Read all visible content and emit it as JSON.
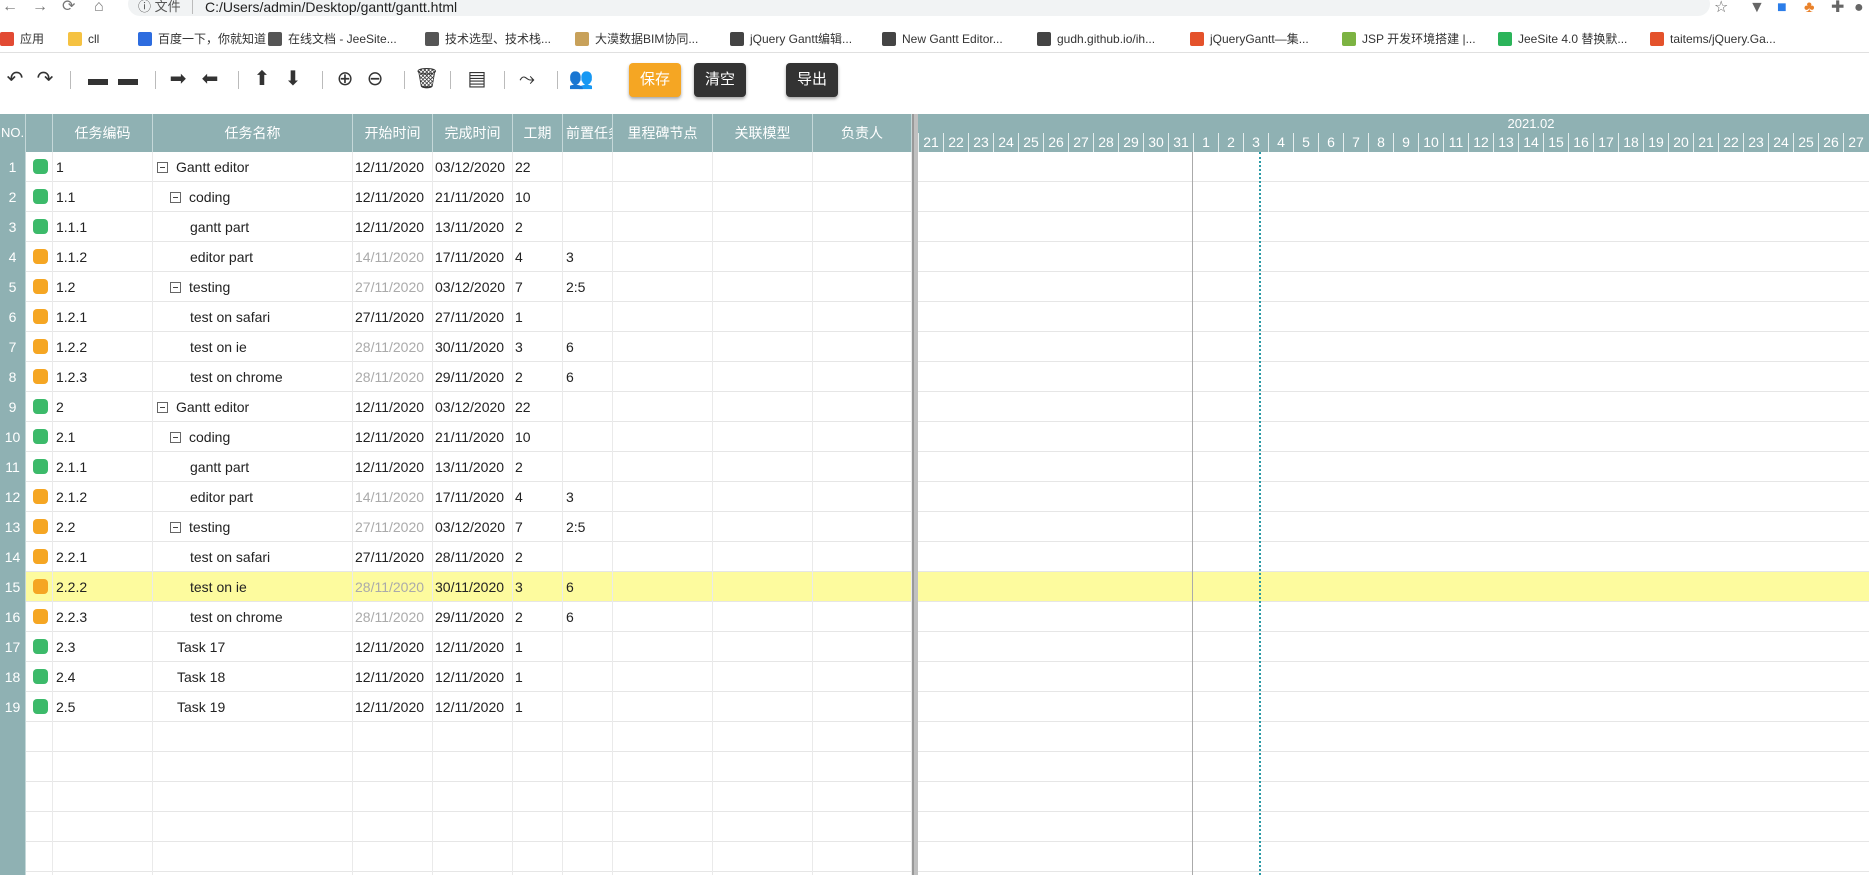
{
  "browser": {
    "url_info": "文件",
    "url": "C:/Users/admin/Desktop/gantt/gantt.html",
    "bookmarks": [
      {
        "label": "应用",
        "icon": "apps-grid-icon",
        "color": "#e24a33"
      },
      {
        "label": "cll",
        "icon": "folder-icon",
        "color": "#f5c242"
      },
      {
        "label": "百度一下，你就知道",
        "icon": "baidu-paw-icon",
        "color": "#2d6cdf"
      },
      {
        "label": "在线文档 - JeeSite...",
        "icon": "js-icon",
        "color": "#555555"
      },
      {
        "label": "技术选型、技术栈...",
        "icon": "js-icon",
        "color": "#555555"
      },
      {
        "label": "大漠数据BIM协同...",
        "icon": "grid-icon",
        "color": "#c8a15a"
      },
      {
        "label": "jQuery Gantt编辑...",
        "icon": "globe-icon",
        "color": "#444444"
      },
      {
        "label": "New Gantt Editor...",
        "icon": "globe-icon",
        "color": "#444444"
      },
      {
        "label": "gudh.github.io/ih...",
        "icon": "globe-icon",
        "color": "#444444"
      },
      {
        "label": "jQueryGantt—集...",
        "icon": "c-red-icon",
        "color": "#e4522b"
      },
      {
        "label": "JSP 开发环境搭建 |...",
        "icon": "lines-icon",
        "color": "#7cb342"
      },
      {
        "label": "JeeSite 4.0 替换默...",
        "icon": "c-green-icon",
        "color": "#2bb45a"
      },
      {
        "label": "taitems/jQuery.Ga...",
        "icon": "c-red-icon",
        "color": "#e4522b"
      }
    ]
  },
  "toolbar": {
    "save_label": "保存",
    "clear_label": "清空",
    "export_label": "导出",
    "save_color": "#f5a623",
    "dark_color": "#333333"
  },
  "grid": {
    "headers": {
      "no": "NO.",
      "code": "任务编码",
      "name": "任务名称",
      "start": "开始时间",
      "end": "完成时间",
      "duration": "工期",
      "depends": "前置任务",
      "milestone": "里程碑节点",
      "relation": "关联模型",
      "owner": "负责人"
    },
    "rows": [
      {
        "no": "1",
        "status": "green",
        "code": "1",
        "name": "Gantt editor",
        "level": 0,
        "collapse": true,
        "start": "12/11/2020",
        "start_dim": false,
        "end": "03/12/2020",
        "duration": "22",
        "depends": ""
      },
      {
        "no": "2",
        "status": "green",
        "code": "1.1",
        "name": "coding",
        "level": 1,
        "collapse": true,
        "start": "12/11/2020",
        "start_dim": false,
        "end": "21/11/2020",
        "duration": "10",
        "depends": ""
      },
      {
        "no": "3",
        "status": "green",
        "code": "1.1.1",
        "name": "gantt part",
        "level": 2,
        "collapse": false,
        "start": "12/11/2020",
        "start_dim": false,
        "end": "13/11/2020",
        "duration": "2",
        "depends": ""
      },
      {
        "no": "4",
        "status": "orange",
        "code": "1.1.2",
        "name": "editor part",
        "level": 2,
        "collapse": false,
        "start": "14/11/2020",
        "start_dim": true,
        "end": "17/11/2020",
        "duration": "4",
        "depends": "3"
      },
      {
        "no": "5",
        "status": "orange",
        "code": "1.2",
        "name": "testing",
        "level": 1,
        "collapse": true,
        "start": "27/11/2020",
        "start_dim": true,
        "end": "03/12/2020",
        "duration": "7",
        "depends": "2:5"
      },
      {
        "no": "6",
        "status": "orange",
        "code": "1.2.1",
        "name": "test on safari",
        "level": 2,
        "collapse": false,
        "start": "27/11/2020",
        "start_dim": false,
        "end": "27/11/2020",
        "duration": "1",
        "depends": ""
      },
      {
        "no": "7",
        "status": "orange",
        "code": "1.2.2",
        "name": "test on ie",
        "level": 2,
        "collapse": false,
        "start": "28/11/2020",
        "start_dim": true,
        "end": "30/11/2020",
        "duration": "3",
        "depends": "6"
      },
      {
        "no": "8",
        "status": "orange",
        "code": "1.2.3",
        "name": "test on chrome",
        "level": 2,
        "collapse": false,
        "start": "28/11/2020",
        "start_dim": true,
        "end": "29/11/2020",
        "duration": "2",
        "depends": "6"
      },
      {
        "no": "9",
        "status": "green",
        "code": "2",
        "name": "Gantt editor",
        "level": 0,
        "collapse": true,
        "start": "12/11/2020",
        "start_dim": false,
        "end": "03/12/2020",
        "duration": "22",
        "depends": ""
      },
      {
        "no": "10",
        "status": "green",
        "code": "2.1",
        "name": "coding",
        "level": 1,
        "collapse": true,
        "start": "12/11/2020",
        "start_dim": false,
        "end": "21/11/2020",
        "duration": "10",
        "depends": ""
      },
      {
        "no": "11",
        "status": "green",
        "code": "2.1.1",
        "name": "gantt part",
        "level": 2,
        "collapse": false,
        "start": "12/11/2020",
        "start_dim": false,
        "end": "13/11/2020",
        "duration": "2",
        "depends": ""
      },
      {
        "no": "12",
        "status": "orange",
        "code": "2.1.2",
        "name": "editor part",
        "level": 2,
        "collapse": false,
        "start": "14/11/2020",
        "start_dim": true,
        "end": "17/11/2020",
        "duration": "4",
        "depends": "3"
      },
      {
        "no": "13",
        "status": "orange",
        "code": "2.2",
        "name": "testing",
        "level": 1,
        "collapse": true,
        "start": "27/11/2020",
        "start_dim": true,
        "end": "03/12/2020",
        "duration": "7",
        "depends": "2:5"
      },
      {
        "no": "14",
        "status": "orange",
        "code": "2.2.1",
        "name": "test on safari",
        "level": 2,
        "collapse": false,
        "start": "27/11/2020",
        "start_dim": false,
        "end": "28/11/2020",
        "duration": "2",
        "depends": ""
      },
      {
        "no": "15",
        "status": "orange",
        "code": "2.2.2",
        "name": "test on ie",
        "level": 2,
        "collapse": false,
        "start": "28/11/2020",
        "start_dim": true,
        "end": "30/11/2020",
        "duration": "3",
        "depends": "6",
        "highlight": true
      },
      {
        "no": "16",
        "status": "orange",
        "code": "2.2.3",
        "name": "test on chrome",
        "level": 2,
        "collapse": false,
        "start": "28/11/2020",
        "start_dim": true,
        "end": "29/11/2020",
        "duration": "2",
        "depends": "6"
      },
      {
        "no": "17",
        "status": "green",
        "code": "2.3",
        "name": "Task 17",
        "level": 1,
        "collapse": false,
        "start": "12/11/2020",
        "start_dim": false,
        "end": "12/11/2020",
        "duration": "1",
        "depends": ""
      },
      {
        "no": "18",
        "status": "green",
        "code": "2.4",
        "name": "Task 18",
        "level": 1,
        "collapse": false,
        "start": "12/11/2020",
        "start_dim": false,
        "end": "12/11/2020",
        "duration": "1",
        "depends": ""
      },
      {
        "no": "19",
        "status": "green",
        "code": "2.5",
        "name": "Task 19",
        "level": 1,
        "collapse": false,
        "start": "12/11/2020",
        "start_dim": false,
        "end": "12/11/2020",
        "duration": "1",
        "depends": ""
      }
    ],
    "status_colors": {
      "green": "#3cba6a",
      "orange": "#f5a623"
    },
    "highlight_color": "#fdfb9e"
  },
  "gantt": {
    "month_label": "2021.02",
    "days": [
      "21",
      "22",
      "23",
      "24",
      "25",
      "26",
      "27",
      "28",
      "29",
      "30",
      "31",
      "1",
      "2",
      "3",
      "4",
      "5",
      "6",
      "7",
      "8",
      "9",
      "10",
      "11",
      "12",
      "13",
      "14",
      "15",
      "16",
      "17",
      "18",
      "19",
      "20",
      "21",
      "22",
      "23",
      "24",
      "25",
      "26",
      "27"
    ]
  }
}
